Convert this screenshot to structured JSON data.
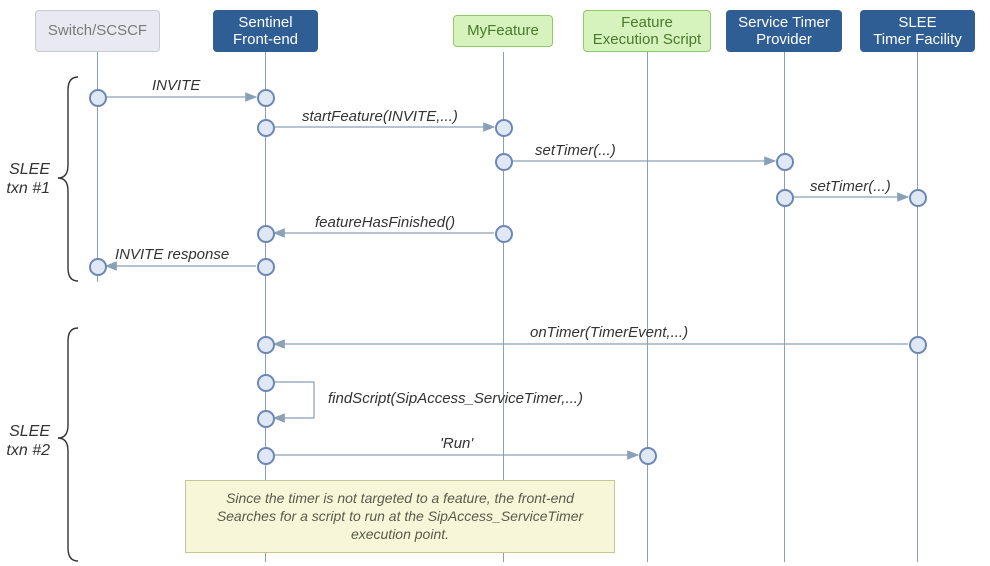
{
  "participants": {
    "scscf": "Switch/SCSCF",
    "frontend": "Sentinel\nFront-end",
    "myfeature": "MyFeature",
    "fes": "Feature\nExecution Script",
    "stp": "Service Timer\nProvider",
    "stf": "SLEE\nTimer Facility"
  },
  "txn": {
    "t1": "SLEE\ntxn #1",
    "t2": "SLEE\ntxn #2"
  },
  "msgs": {
    "invite": "INVITE",
    "startFeature": "startFeature(INVITE,...)",
    "setTimer1": "setTimer(...)",
    "setTimer2": "setTimer(...)",
    "featureHasFinished": "featureHasFinished()",
    "inviteResponse": "INVITE response",
    "onTimer": "onTimer(TimerEvent,...)",
    "findScript": "findScript(SipAccess_ServiceTimer,...)",
    "run": "'Run'"
  },
  "note": "Since the timer is not targeted to a feature, the front-end\nSearches for a script to run at the SipAccess_ServiceTimer\nexecution point.",
  "chart_data": {
    "type": "sequence_diagram",
    "participants": [
      {
        "id": "scscf",
        "label": "Switch/SCSCF"
      },
      {
        "id": "frontend",
        "label": "Sentinel Front-end"
      },
      {
        "id": "myfeature",
        "label": "MyFeature"
      },
      {
        "id": "fes",
        "label": "Feature Execution Script"
      },
      {
        "id": "stp",
        "label": "Service Timer Provider"
      },
      {
        "id": "stf",
        "label": "SLEE Timer Facility"
      }
    ],
    "groups": [
      {
        "label": "SLEE txn #1",
        "messages": [
          {
            "from": "scscf",
            "to": "frontend",
            "label": "INVITE"
          },
          {
            "from": "frontend",
            "to": "myfeature",
            "label": "startFeature(INVITE,...)"
          },
          {
            "from": "myfeature",
            "to": "stp",
            "label": "setTimer(...)"
          },
          {
            "from": "stp",
            "to": "stf",
            "label": "setTimer(...)"
          },
          {
            "from": "myfeature",
            "to": "frontend",
            "label": "featureHasFinished()"
          },
          {
            "from": "frontend",
            "to": "scscf",
            "label": "INVITE response"
          }
        ]
      },
      {
        "label": "SLEE txn #2",
        "messages": [
          {
            "from": "stf",
            "to": "frontend",
            "label": "onTimer(TimerEvent,...)"
          },
          {
            "from": "frontend",
            "to": "frontend",
            "label": "findScript(SipAccess_ServiceTimer,...)",
            "self": true
          },
          {
            "from": "frontend",
            "to": "fes",
            "label": "'Run'"
          }
        ],
        "note": {
          "attached_to": "frontend",
          "text": "Since the timer is not targeted to a feature, the front-end Searches for a script to run at the SipAccess_ServiceTimer execution point."
        }
      }
    ]
  }
}
